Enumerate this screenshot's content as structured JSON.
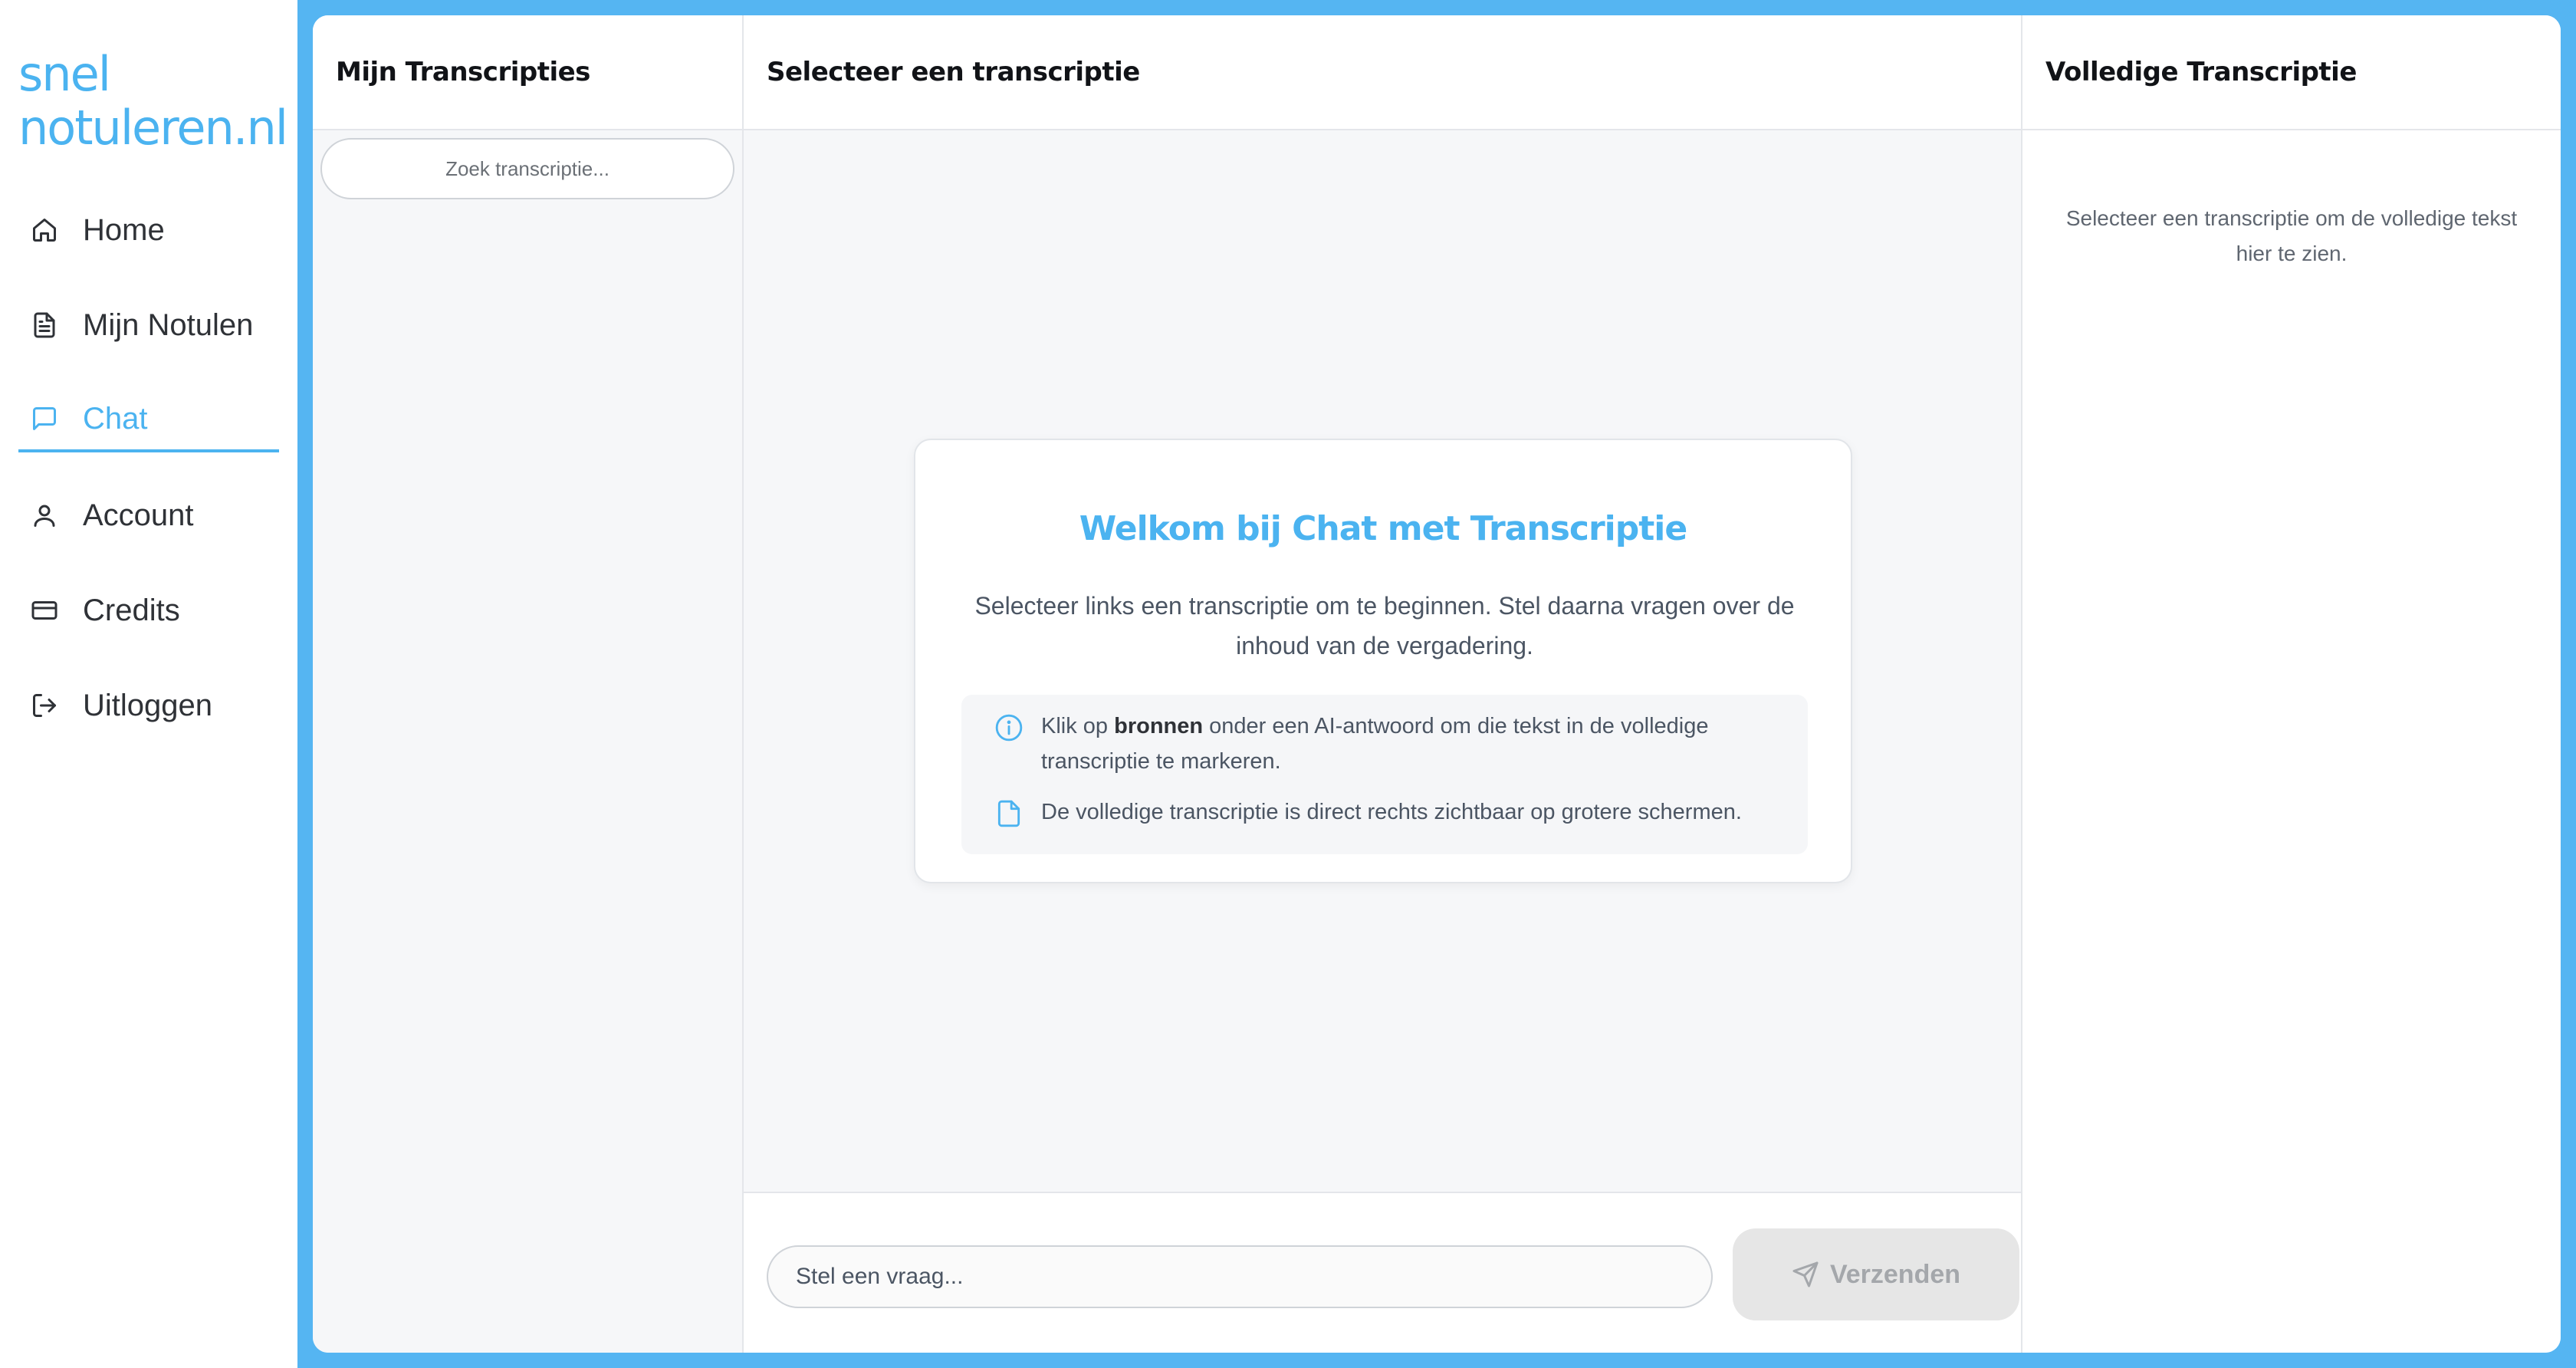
{
  "brand": {
    "line1": "snel",
    "line2": "notuleren.nl",
    "color": "#4bb3f0"
  },
  "nav": {
    "items": [
      {
        "label": "Home",
        "icon": "home-icon"
      },
      {
        "label": "Mijn Notulen",
        "icon": "document-icon"
      },
      {
        "label": "Chat",
        "icon": "chat-icon",
        "active": true
      },
      {
        "label": "Account",
        "icon": "user-icon"
      },
      {
        "label": "Credits",
        "icon": "credit-card-icon"
      },
      {
        "label": "Uitloggen",
        "icon": "logout-icon"
      }
    ]
  },
  "left_panel": {
    "title": "Mijn Transcripties",
    "search_placeholder": "Zoek transcriptie..."
  },
  "chat_panel": {
    "title": "Selecteer een transcriptie",
    "welcome": {
      "title": "Welkom bij Chat met Transcriptie",
      "description": "Selecteer links een transcriptie om te beginnen. Stel daarna vragen over de inhoud van de vergadering.",
      "tip1": {
        "icon": "info-icon",
        "prefix": "Klik op ",
        "bold": "bronnen",
        "suffix": " onder een AI-antwoord om die tekst in de volledige transcriptie te markeren."
      },
      "tip2": {
        "icon": "file-icon",
        "text": "De volledige transcriptie is direct rechts zichtbaar op grotere schermen."
      }
    },
    "input_placeholder": "Stel een vraag...",
    "send_label": "Verzenden"
  },
  "right_panel": {
    "title": "Volledige Transcriptie",
    "empty_message": "Selecteer een transcriptie om de volledige tekst hier te zien."
  },
  "colors": {
    "accent": "#4bb3f0",
    "frame": "#55b5f2",
    "panel_bg": "#f6f7f9"
  }
}
